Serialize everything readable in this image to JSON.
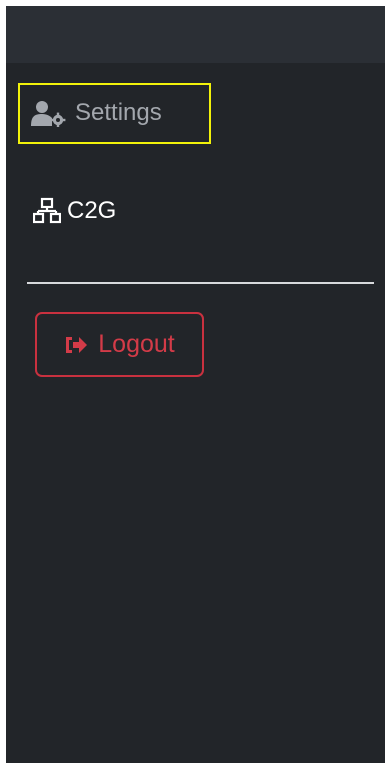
{
  "sidebar": {
    "items": [
      {
        "label": "Settings",
        "icon": "user-gear-icon",
        "state": "hover-highlighted"
      },
      {
        "label": "C2G",
        "icon": "network-icon"
      }
    ]
  },
  "logout": {
    "label": "Logout",
    "icon": "sign-out-icon",
    "color": "#d33b48"
  },
  "colors": {
    "background": "#222529",
    "topbar": "#2b2f35",
    "highlight": "#f2f20a",
    "muted_text": "#a3a7ad"
  }
}
